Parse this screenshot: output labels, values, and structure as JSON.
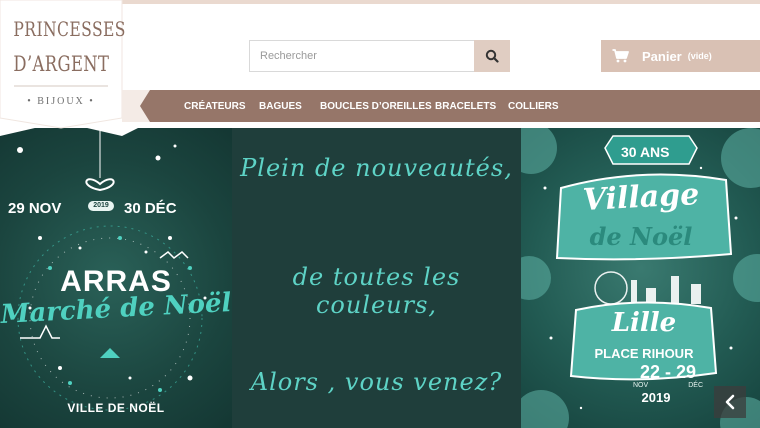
{
  "logo": {
    "line1": "PRINCESSES",
    "line2": "D’ARGENT",
    "subtitle": "• BIJOUX •"
  },
  "search": {
    "placeholder": "Rechercher",
    "icon": "search-icon"
  },
  "cart": {
    "label": "Panier",
    "status": "(vide)",
    "icon": "cart-icon"
  },
  "nav": {
    "items": [
      "CRÉATEURS",
      "BAGUES",
      "BOUCLES D’OREILLES",
      "BRACELETS",
      "COLLIERS"
    ]
  },
  "banner": {
    "left": {
      "date_start": "29 NOV",
      "year": "2019",
      "date_end": "30 DÉC",
      "city": "ARRAS",
      "event": "Marché de Noël",
      "footer": "VILLE DE NOËL"
    },
    "middle": {
      "lines": [
        "Plein de nouveautés,",
        "de toutes les couleurs,",
        "Alors , vous venez?"
      ]
    },
    "right": {
      "anniversary": "30 ANS",
      "title_line1": "Village",
      "title_line2": "de Noël",
      "city": "Lille",
      "place": "PLACE RIHOUR",
      "dates": "22 - 29",
      "month_start": "NOV",
      "month_end": "DÉC",
      "year": "2019"
    },
    "next_icon": "chevron-left-icon"
  },
  "colors": {
    "nav_bg": "#967669",
    "accent": "#d9c1b4",
    "banner_teal": "#5ed3c6"
  }
}
